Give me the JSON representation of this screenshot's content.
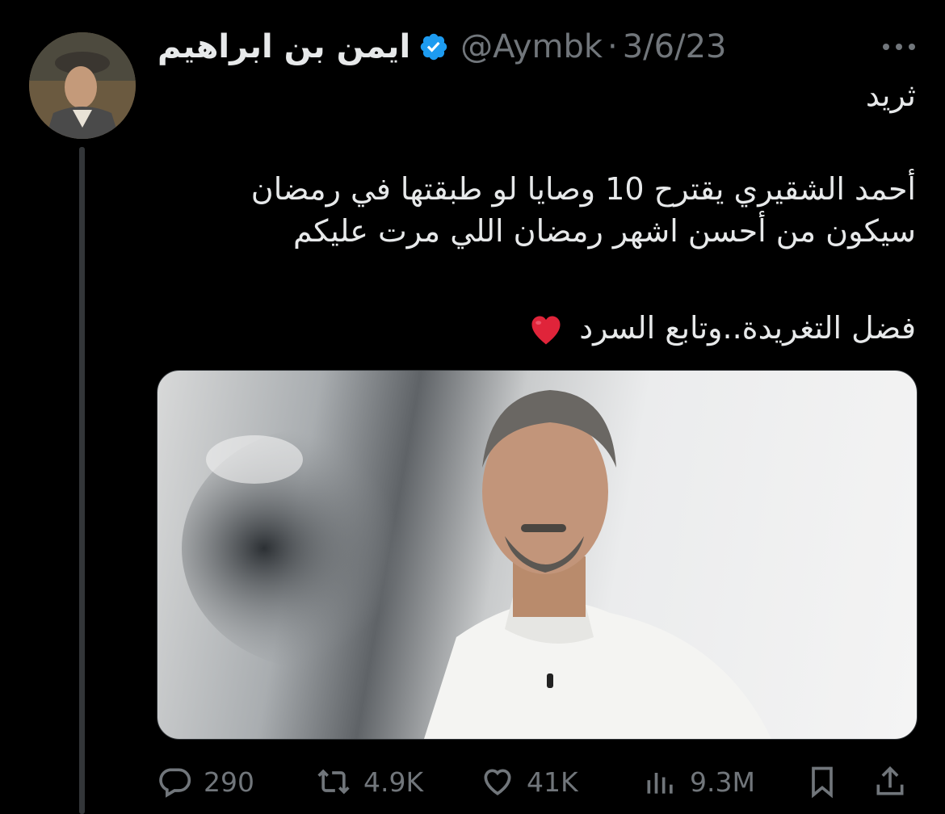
{
  "tweet": {
    "author_name": "ايمن بن ابراهيم",
    "handle": "@Aymbk",
    "separator": "·",
    "date": "3/6/23",
    "verified_color": "#1d9bf0",
    "lines": [
      "ثريد",
      "أحمد الشقيري يقترح 10 وصايا لو طبقتها في رمضان",
      "سيكون من أحسن اشهر رمضان اللي مرت عليكم",
      "فضل التغريدة..وتابع السرد"
    ],
    "emoji": "red-heart-emoji",
    "media_alt_icon": "photo"
  },
  "actions": {
    "replies": "290",
    "retweets": "4.9K",
    "likes": "41K",
    "views": "9.3M"
  },
  "icons": {
    "more": "more-horizontal-icon",
    "reply": "comment-bubble-icon",
    "retweet": "retweet-arrows-icon",
    "like": "heart-outline-icon",
    "views": "bar-chart-icon",
    "bookmark": "bookmark-icon",
    "share": "share-upload-icon"
  },
  "colors": {
    "background": "#000000",
    "text": "#e7e9ea",
    "secondary": "#71767b",
    "heart_emoji": "#e0243a"
  }
}
